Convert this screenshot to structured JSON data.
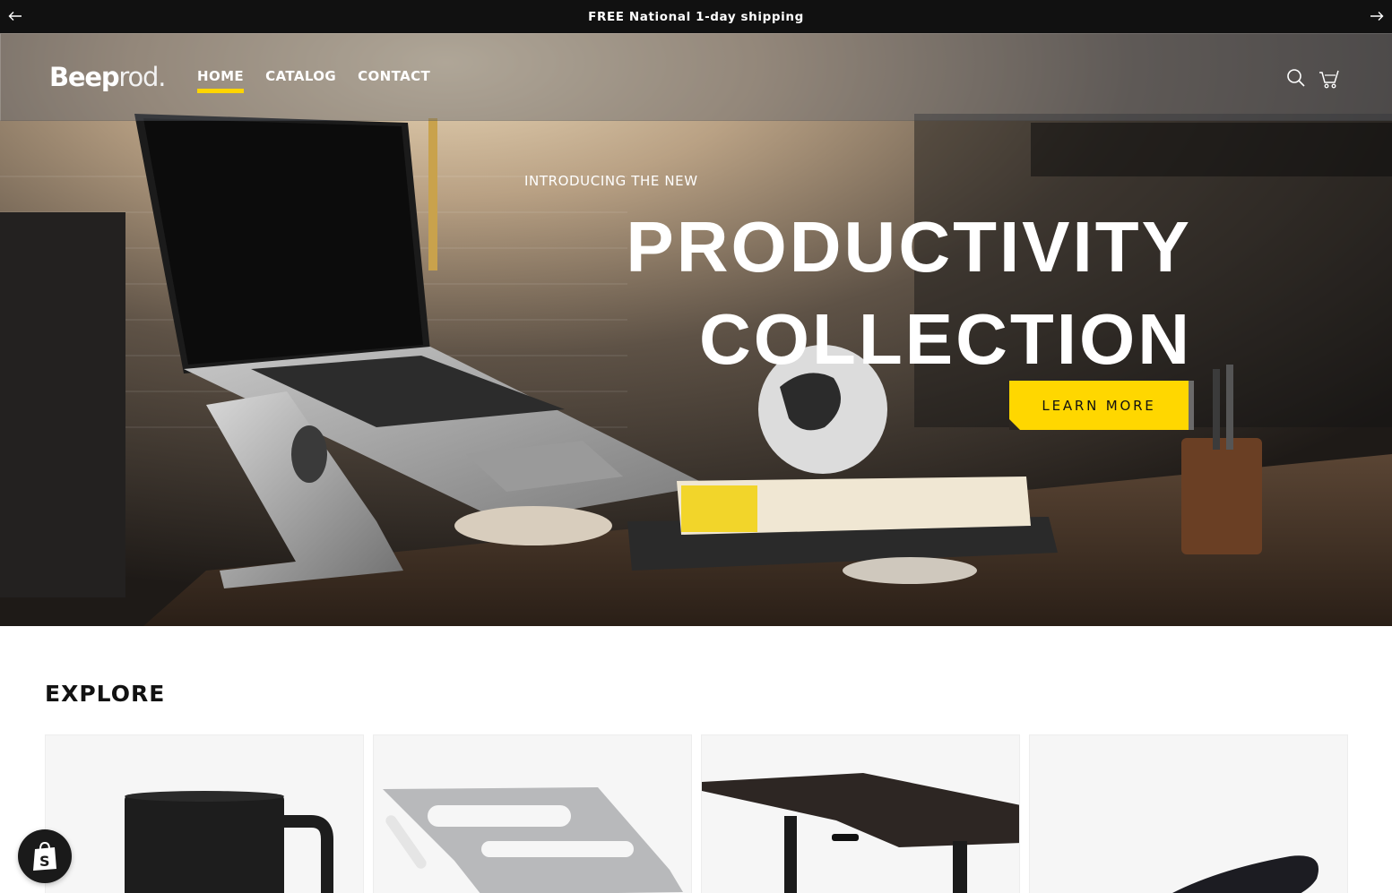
{
  "announcement": {
    "text": "FREE National 1-day shipping",
    "prev_icon": "arrow-left-icon",
    "next_icon": "arrow-right-icon"
  },
  "header": {
    "logo_bold": "Beep",
    "logo_light": "rod.",
    "nav": [
      {
        "label": "HOME",
        "active": true
      },
      {
        "label": "CATALOG",
        "active": false
      },
      {
        "label": "CONTACT",
        "active": false
      }
    ],
    "icons": [
      "search-icon",
      "cart-icon"
    ],
    "accent_color": "#ffd500"
  },
  "hero": {
    "eyebrow": "INTRODUCING THE NEW",
    "title_line1": "PRODUCTIVITY",
    "title_line2": "COLLECTION",
    "button_label": "LEARN MORE",
    "button_color": "#ffd700"
  },
  "explore": {
    "title": "EXPLORE",
    "cards": [
      {
        "image": "black-mug"
      },
      {
        "image": "silver-laptop-stand"
      },
      {
        "image": "standing-desk"
      },
      {
        "image": "wrist-rest"
      }
    ]
  },
  "badge": {
    "icon": "shopify-bag-icon"
  }
}
